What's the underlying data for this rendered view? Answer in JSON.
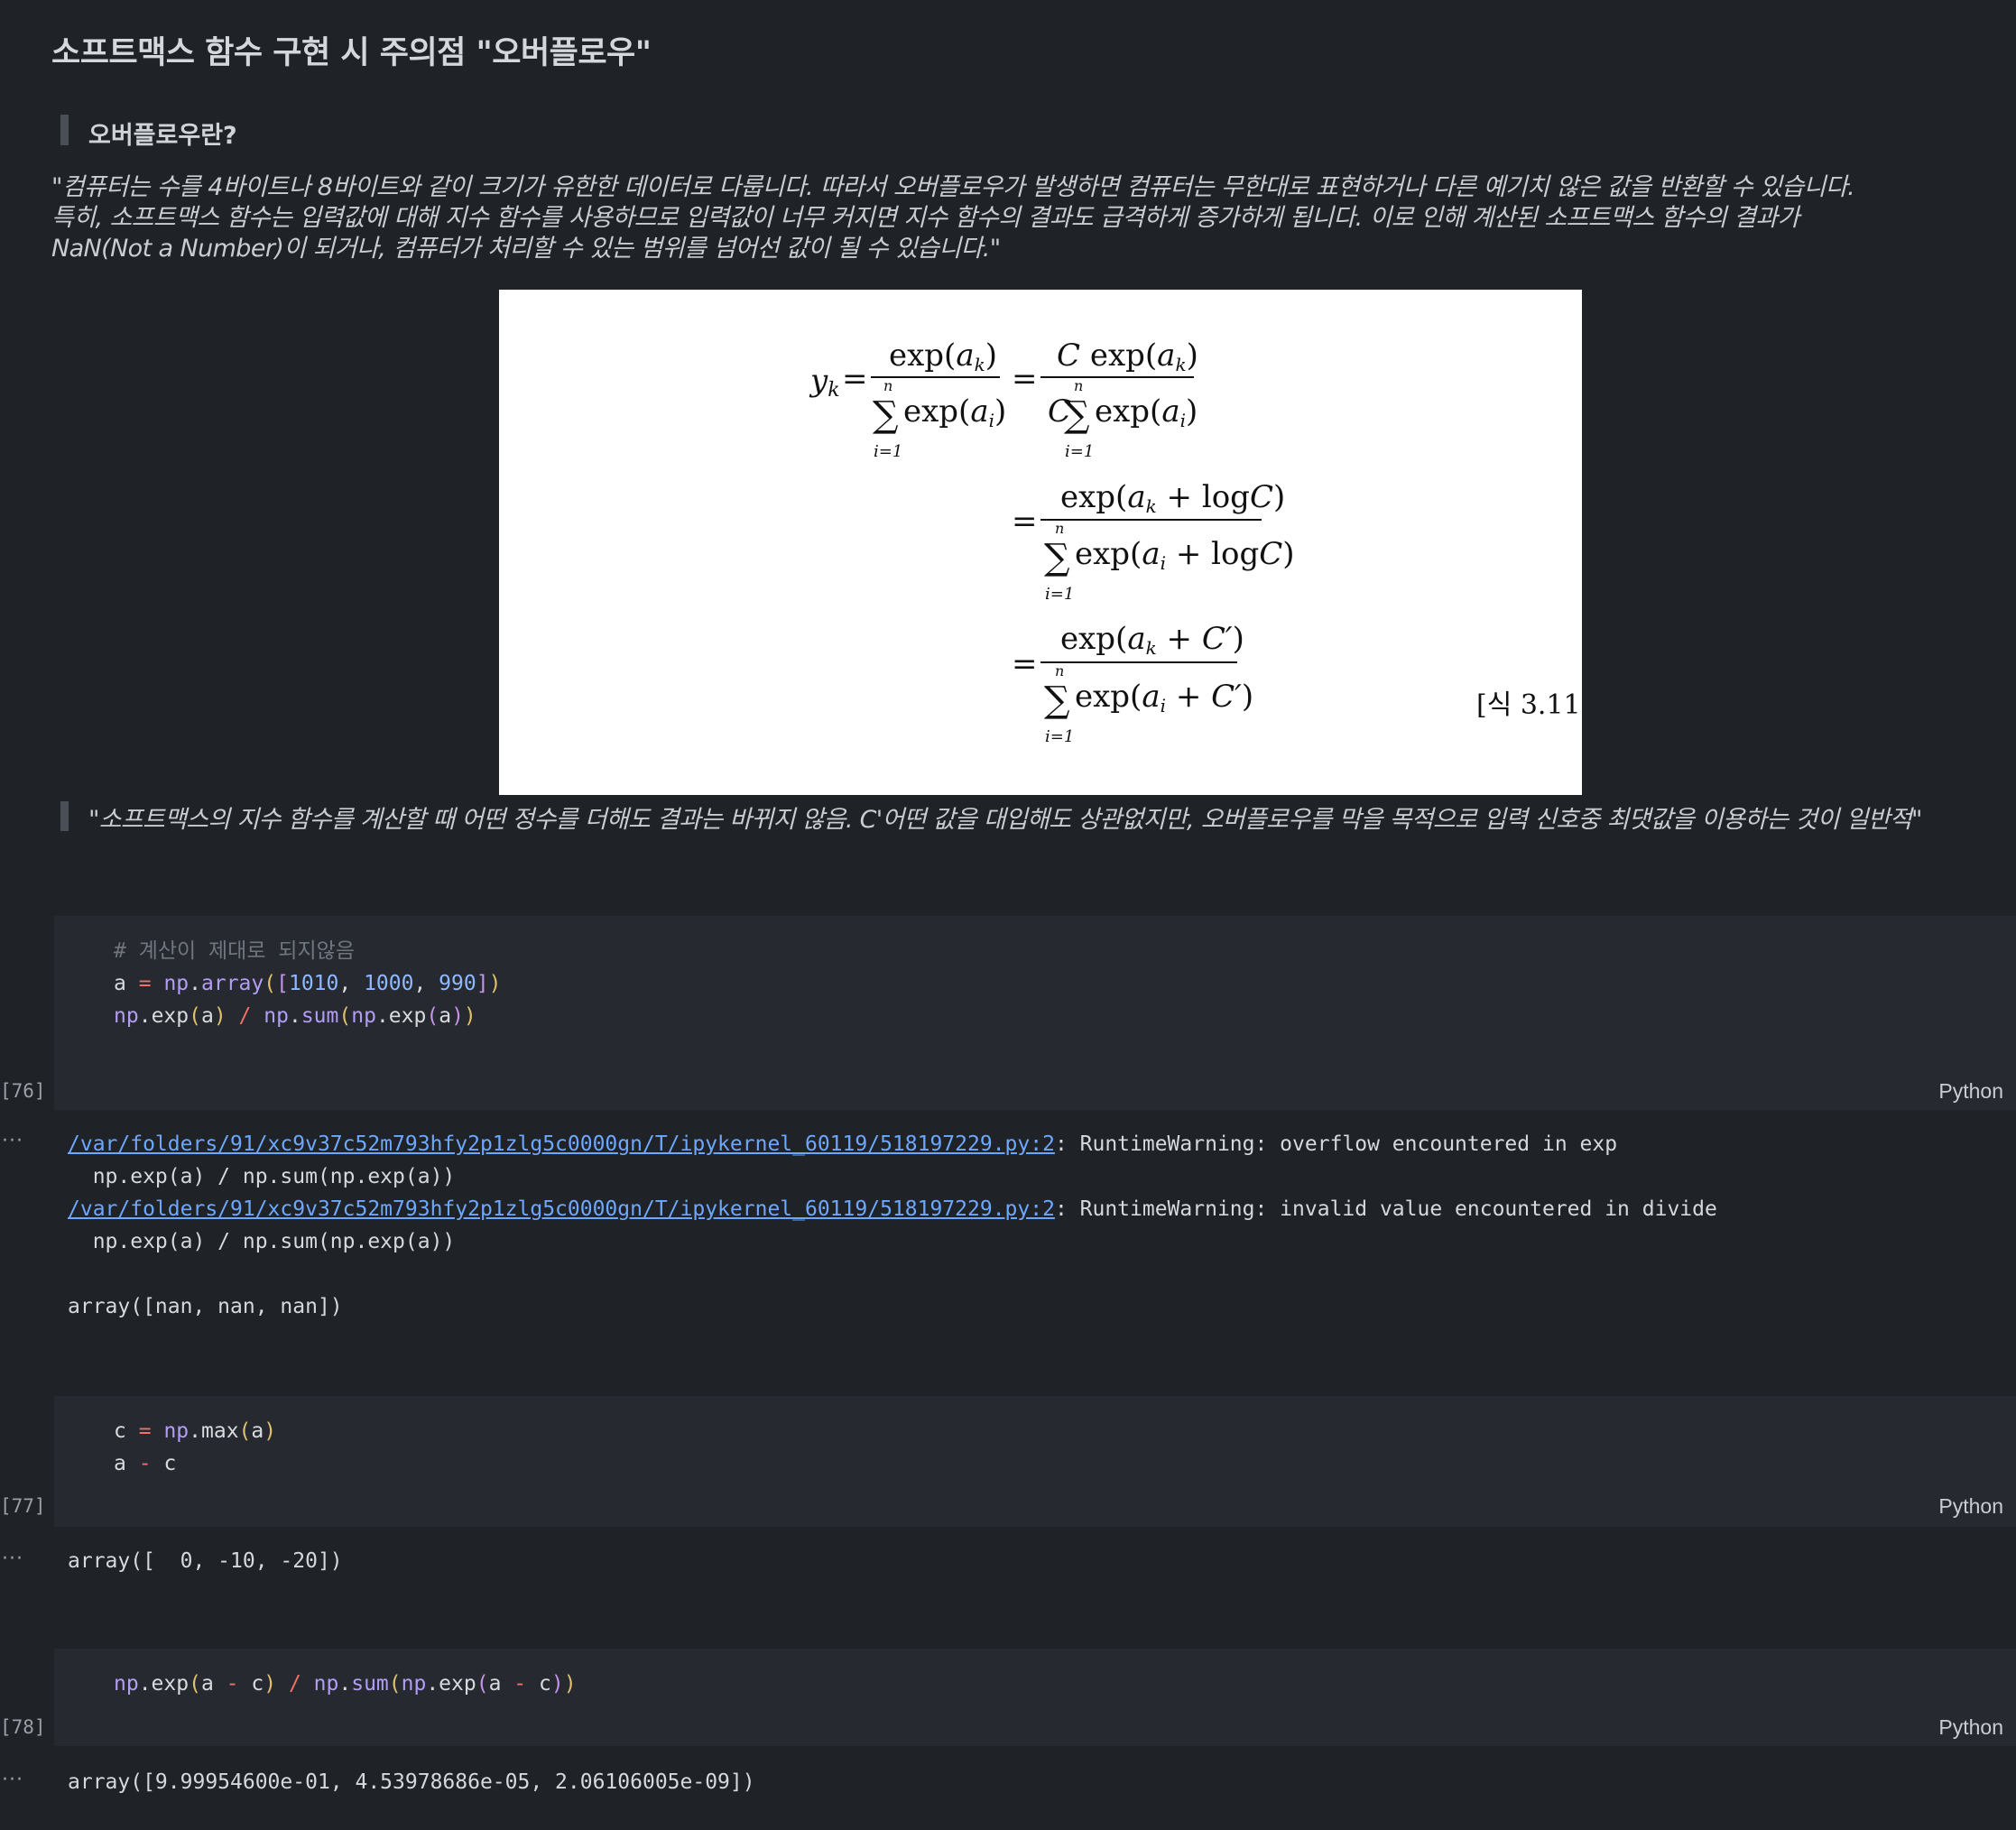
{
  "title": "소프트맥스 함수 구현 시 주의점 \"오버플로우\"",
  "section_heading": "오버플로우란?",
  "paragraph": [
    "\"컴퓨터는 수를 4바이트나 8바이트와 같이 크기가 유한한 데이터로 다룹니다. 따라서 오버플로우가 발생하면 컴퓨터는 무한대로 표현하거나 다른 예기치 않은 값을 반환할 수 있습니다.",
    "특히, 소프트맥스 함수는 입력값에 대해 지수 함수를 사용하므로 입력값이 너무 커지면 지수 함수의 결과도 급격하게 증가하게 됩니다. 이로 인해 계산된 소프트맥스 함수의 결과가",
    "NaN(Not a Number)이 되거나, 컴퓨터가 처리할 수 있는 범위를 넘어선 값이 될 수 있습니다.\""
  ],
  "formula": {
    "label": "[식 3.11]",
    "lhs": "y",
    "lhs_sub": "k",
    "exp": "exp",
    "C": "C",
    "logC": "log",
    "sum_top": "n",
    "sum_bottom": "i=1"
  },
  "quote": "\"소프트맥스의 지수 함수를 계산할 때 어떤 정수를 더해도 결과는 바뀌지 않음. C'어떤 값을 대입해도 상관없지만, 오버플로우를 막을 목적으로 입력 신호중 최댓값을 이용하는 것이 일반적\"",
  "cells": [
    {
      "exec_count": "[76]",
      "language": "Python",
      "code": {
        "comment": "# 계산이 제대로 되지않음",
        "line2": {
          "var": "a",
          "op": "=",
          "mod": "np",
          "fn": "array",
          "nums": [
            "1010",
            "1000",
            "990"
          ]
        },
        "line3": {
          "mod": "np",
          "fn1": "exp",
          "arg": "a",
          "op": "/",
          "fn2": "sum",
          "fn3": "exp"
        }
      },
      "output": {
        "ellipsis": "···",
        "warnings": [
          {
            "path": "/var/folders/91/xc9v37c52m793hfy2p1zlg5c0000gn/T/ipykernel_60119/518197229.py:2",
            "message": ": RuntimeWarning: overflow encountered in exp",
            "source": "  np.exp(a) / np.sum(np.exp(a))"
          },
          {
            "path": "/var/folders/91/xc9v37c52m793hfy2p1zlg5c0000gn/T/ipykernel_60119/518197229.py:2",
            "message": ": RuntimeWarning: invalid value encountered in divide",
            "source": "  np.exp(a) / np.sum(np.exp(a))"
          }
        ],
        "result": "array([nan, nan, nan])"
      }
    },
    {
      "exec_count": "[77]",
      "language": "Python",
      "code": {
        "line1": {
          "var": "c",
          "op": "=",
          "mod": "np",
          "fn": "max",
          "arg": "a"
        },
        "line2": {
          "a": "a",
          "op": "-",
          "c": "c"
        }
      },
      "output": {
        "ellipsis": "···",
        "result": "array([  0, -10, -20])"
      }
    },
    {
      "exec_count": "[78]",
      "language": "Python",
      "code": {
        "line1": "np.exp(a - c) / np.sum(np.exp(a - c))"
      },
      "output": {
        "ellipsis": "···",
        "result": "array([9.99954600e-01, 4.53978686e-05, 2.06106005e-09])"
      }
    }
  ]
}
